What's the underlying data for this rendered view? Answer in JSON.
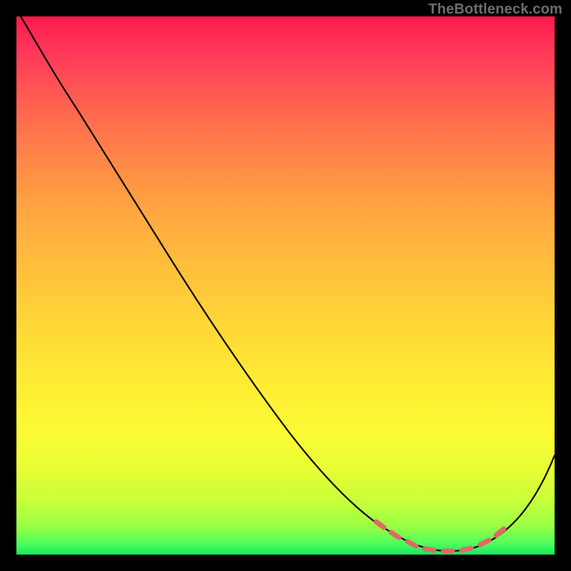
{
  "watermark": "TheBottleneck.com",
  "colors": {
    "dash": "#e06a65",
    "curve": "#000000"
  },
  "chart_data": {
    "type": "line",
    "title": "",
    "xlabel": "",
    "ylabel": "",
    "xlim": [
      0,
      100
    ],
    "ylim": [
      0,
      100
    ],
    "series": [
      {
        "name": "bottleneck-curve",
        "x": [
          0,
          4,
          8,
          12,
          18,
          25,
          35,
          45,
          55,
          62,
          68,
          72,
          75,
          78,
          81,
          85,
          90,
          95,
          100
        ],
        "y": [
          100,
          98,
          95,
          91,
          84,
          74,
          59,
          44,
          29,
          18,
          11,
          7,
          4,
          2,
          1,
          1,
          4,
          11,
          22
        ]
      }
    ],
    "annotations": [
      {
        "name": "dash-region",
        "x_start": 68,
        "x_end": 90,
        "style": "dashed",
        "color": "#e06a65"
      }
    ]
  }
}
